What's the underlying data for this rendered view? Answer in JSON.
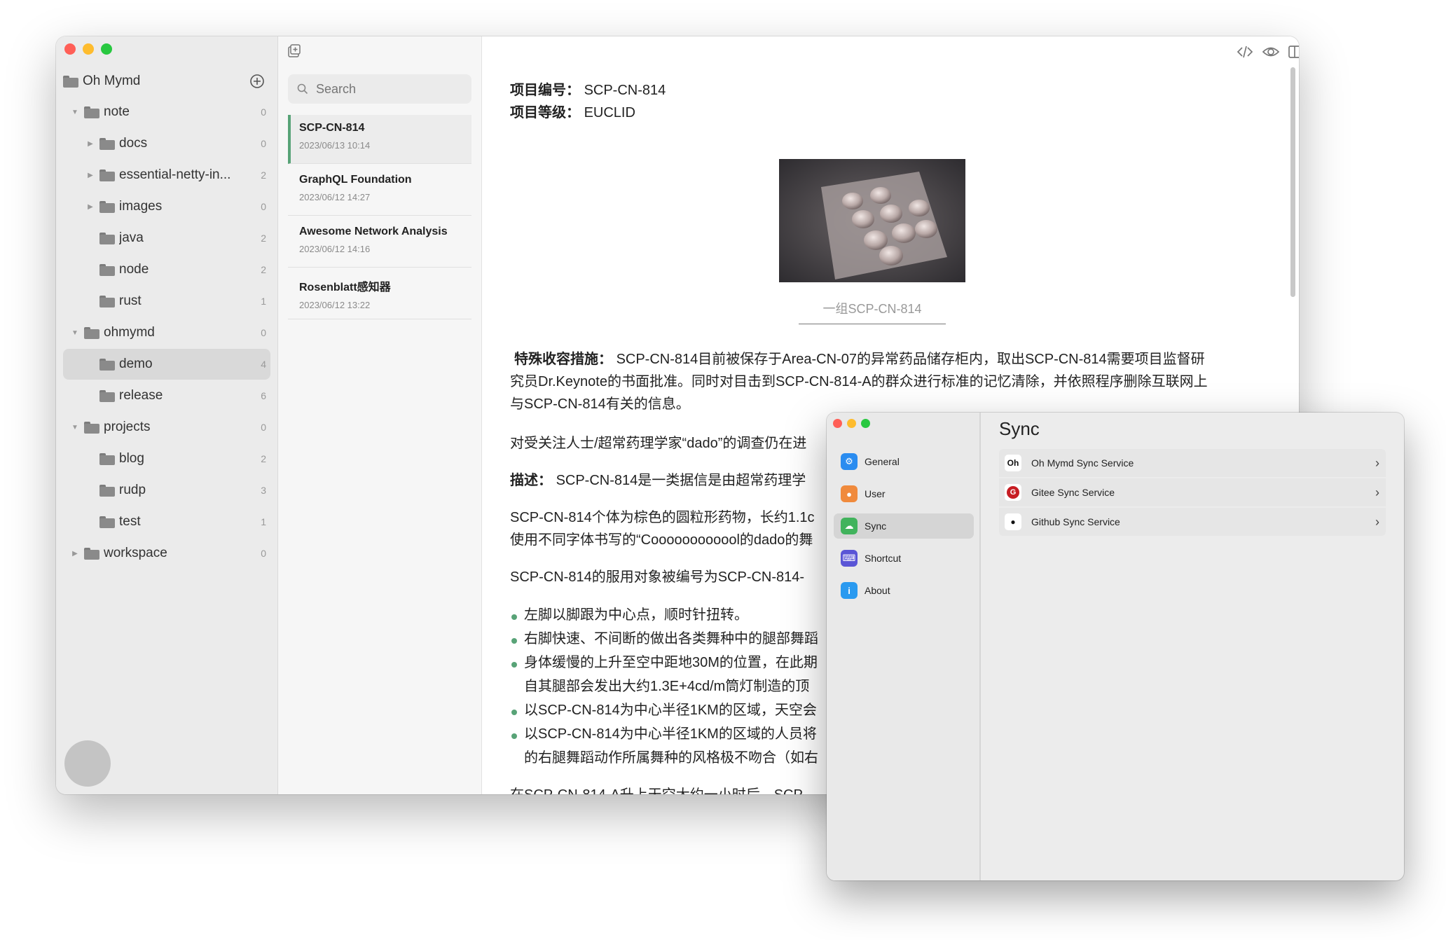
{
  "colors": {
    "accent": "#58a377",
    "close": "#ff5f57",
    "minimize": "#febc2e",
    "zoom": "#28c840"
  },
  "sidebar": {
    "root_label": "Oh Mymd",
    "items": [
      {
        "label": "note",
        "count": "0",
        "level": 0,
        "arrow": "down"
      },
      {
        "label": "docs",
        "count": "0",
        "level": 1,
        "arrow": "right"
      },
      {
        "label": "essential-netty-in...",
        "count": "2",
        "level": 1,
        "arrow": "right"
      },
      {
        "label": "images",
        "count": "0",
        "level": 1,
        "arrow": "right"
      },
      {
        "label": "java",
        "count": "2",
        "level": 1,
        "arrow": "none"
      },
      {
        "label": "node",
        "count": "2",
        "level": 1,
        "arrow": "none"
      },
      {
        "label": "rust",
        "count": "1",
        "level": 1,
        "arrow": "none"
      },
      {
        "label": "ohmymd",
        "count": "0",
        "level": 0,
        "arrow": "down"
      },
      {
        "label": "demo",
        "count": "4",
        "level": 1,
        "arrow": "none",
        "selected": true
      },
      {
        "label": "release",
        "count": "6",
        "level": 1,
        "arrow": "none"
      },
      {
        "label": "projects",
        "count": "0",
        "level": 0,
        "arrow": "down"
      },
      {
        "label": "blog",
        "count": "2",
        "level": 1,
        "arrow": "none"
      },
      {
        "label": "rudp",
        "count": "3",
        "level": 1,
        "arrow": "none"
      },
      {
        "label": "test",
        "count": "1",
        "level": 1,
        "arrow": "none"
      },
      {
        "label": "workspace",
        "count": "0",
        "level": 0,
        "arrow": "right"
      }
    ]
  },
  "notelist": {
    "search_placeholder": "Search",
    "notes": [
      {
        "title": "SCP-CN-814",
        "date": "2023/06/13 10:14",
        "selected": true
      },
      {
        "title": "GraphQL Foundation",
        "date": "2023/06/12 14:27"
      },
      {
        "title": "Awesome Network Analysis",
        "date": "2023/06/12 14:16"
      },
      {
        "title": "Rosenblatt感知器",
        "date": "2023/06/12 13:22"
      }
    ]
  },
  "editor": {
    "item_no_label": "项目编号：",
    "item_no_value": "SCP-CN-814",
    "item_class_label": "项目等级：",
    "item_class_value": "EUCLID",
    "image_caption": "一组SCP-CN-814",
    "containment_label": "特殊收容措施：",
    "containment_line1": "SCP-CN-814目前被保存于Area-CN-07的异常药品储存柜内，取出SCP-CN-814需要项目监督研",
    "containment_line2": "究员Dr.Keynote的书面批准。同时对目击到SCP-CN-814-A的群众进行标准的记忆清除，并依照程序删除互联网上",
    "containment_line3": "与SCP-CN-814有关的信息。",
    "para_attention": "对受关注人士/超常药理学家“dado”的调查仍在进",
    "desc_label": "描述：",
    "desc_text": "SCP-CN-814是一类据信是由超常药理学",
    "para_individual1": "SCP-CN-814个体为棕色的圆粒形药物，长约1.1c",
    "para_individual2": "使用不同字体书写的“Coooooooooool的dado的舞",
    "para_subject": "SCP-CN-814的服用对象被编号为SCP-CN-814-",
    "bullets": [
      "左脚以脚跟为中心点，顺时针扭转。",
      "右脚快速、不间断的做出各类舞种中的腿部舞蹈",
      "身体缓慢的上升至空中距地30M的位置，在此期",
      "以SCP-CN-814为中心半径1KM的区域，天空会",
      "以SCP-CN-814为中心半径1KM的区域的人员将"
    ],
    "bullet3_cont": "自其腿部会发出大约1.3E+4cd/m筒灯制造的顶",
    "bullet5_cont": "的右腿舞蹈动作所属舞种的风格极不吻合（如右",
    "cut_line": "在SCP-CN-814-A升上天空大约一小时后，SCP"
  },
  "settings": {
    "title": "Sync",
    "menu": [
      {
        "label": "General",
        "icon": "gear-icon",
        "color": "#2a8cf0",
        "glyph": "⚙"
      },
      {
        "label": "User",
        "icon": "user-icon",
        "color": "#f08a3c",
        "glyph": "●"
      },
      {
        "label": "Sync",
        "icon": "cloud-icon",
        "color": "#41b35c",
        "glyph": "☁",
        "selected": true
      },
      {
        "label": "Shortcut",
        "icon": "keyboard-icon",
        "color": "#5a55d6",
        "glyph": "⌨"
      },
      {
        "label": "About",
        "icon": "info-icon",
        "color": "#2a9af0",
        "glyph": "i"
      }
    ],
    "services": [
      {
        "label": "Oh Mymd Sync Service",
        "icon": "ohmymd-logo-icon",
        "glyph": "Oh"
      },
      {
        "label": "Gitee Sync Service",
        "icon": "gitee-logo-icon",
        "glyph": "G"
      },
      {
        "label": "Github Sync Service",
        "icon": "github-logo-icon",
        "glyph": "●"
      }
    ]
  }
}
